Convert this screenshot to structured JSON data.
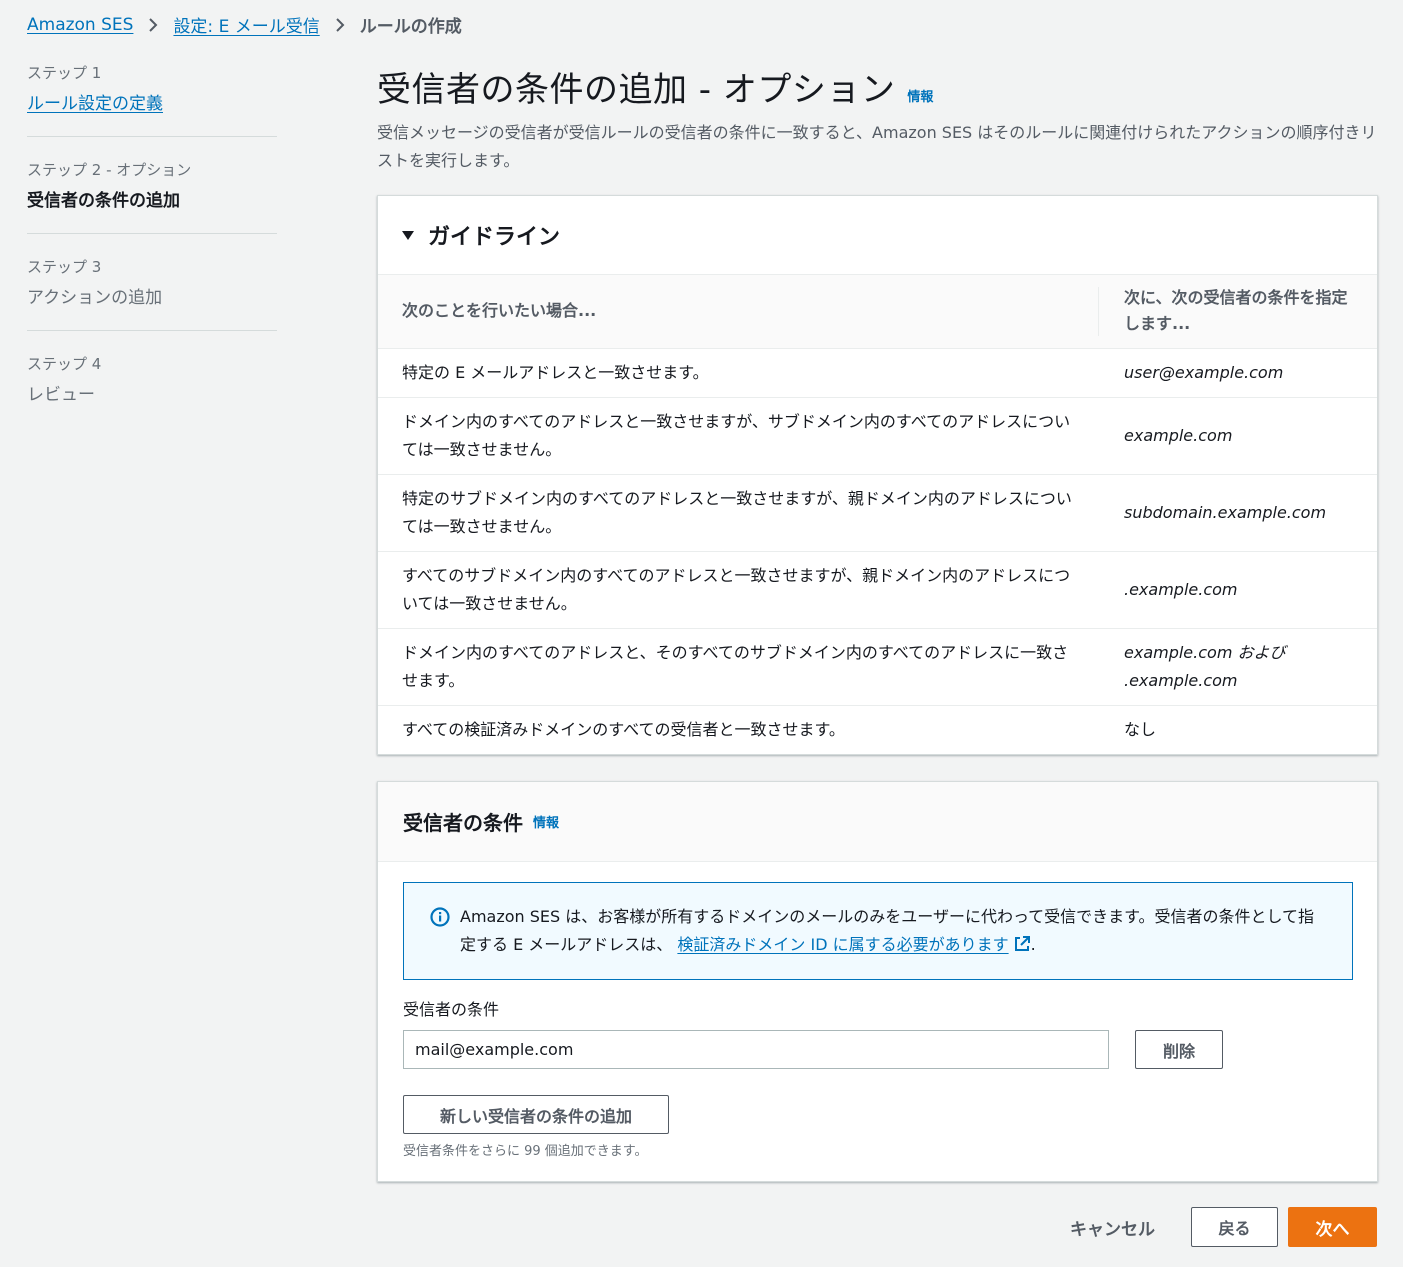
{
  "breadcrumb": {
    "items": [
      "Amazon SES",
      "設定: E メール受信"
    ],
    "current": "ルールの作成"
  },
  "steps": [
    {
      "num": "ステップ 1",
      "label": "ルール設定の定義"
    },
    {
      "num": "ステップ 2 - オプション",
      "label": "受信者の条件の追加"
    },
    {
      "num": "ステップ 3",
      "label": "アクションの追加"
    },
    {
      "num": "ステップ 4",
      "label": "レビュー"
    }
  ],
  "page": {
    "title": "受信者の条件の追加 - オプション",
    "info": "情報",
    "description": "受信メッセージの受信者が受信ルールの受信者の条件に一致すると、Amazon SES はそのルールに関連付けられたアクションの順序付きリストを実行します。"
  },
  "guidelines": {
    "title": "ガイドライン",
    "headers": [
      "次のことを行いたい場合...",
      "次に、次の受信者の条件を指定します..."
    ],
    "rows": [
      {
        "want": "特定の E メールアドレスと一致させます。",
        "condition": "user@example.com"
      },
      {
        "want": "ドメイン内のすべてのアドレスと一致させますが、サブドメイン内のすべてのアドレスについては一致させません。",
        "condition": "example.com"
      },
      {
        "want": "特定のサブドメイン内のすべてのアドレスと一致させますが、親ドメイン内のアドレスについては一致させません。",
        "condition": "subdomain.example.com"
      },
      {
        "want": "すべてのサブドメイン内のすべてのアドレスと一致させますが、親ドメイン内のアドレスについては一致させません。",
        "condition": ".example.com"
      },
      {
        "want": "ドメイン内のすべてのアドレスと、そのすべてのサブドメイン内のすべてのアドレスに一致させます。",
        "condition": "example.com および .example.com"
      },
      {
        "want": "すべての検証済みドメインのすべての受信者と一致させます。",
        "condition": "なし"
      }
    ]
  },
  "recipient": {
    "title": "受信者の条件",
    "info": "情報",
    "alert_text": "Amazon SES は、お客様が所有するドメインのメールのみをユーザーに代わって受信できます。受信者の条件として指定する E メールアドレスは、",
    "alert_link": "検証済みドメイン ID に属する必要があります",
    "alert_end": ".",
    "field_label": "受信者の条件",
    "field_value": "mail@example.com",
    "delete_label": "削除",
    "add_label": "新しい受信者の条件の追加",
    "hint": "受信者条件をさらに 99 個追加できます。"
  },
  "footer": {
    "cancel": "キャンセル",
    "back": "戻る",
    "next": "次へ"
  }
}
